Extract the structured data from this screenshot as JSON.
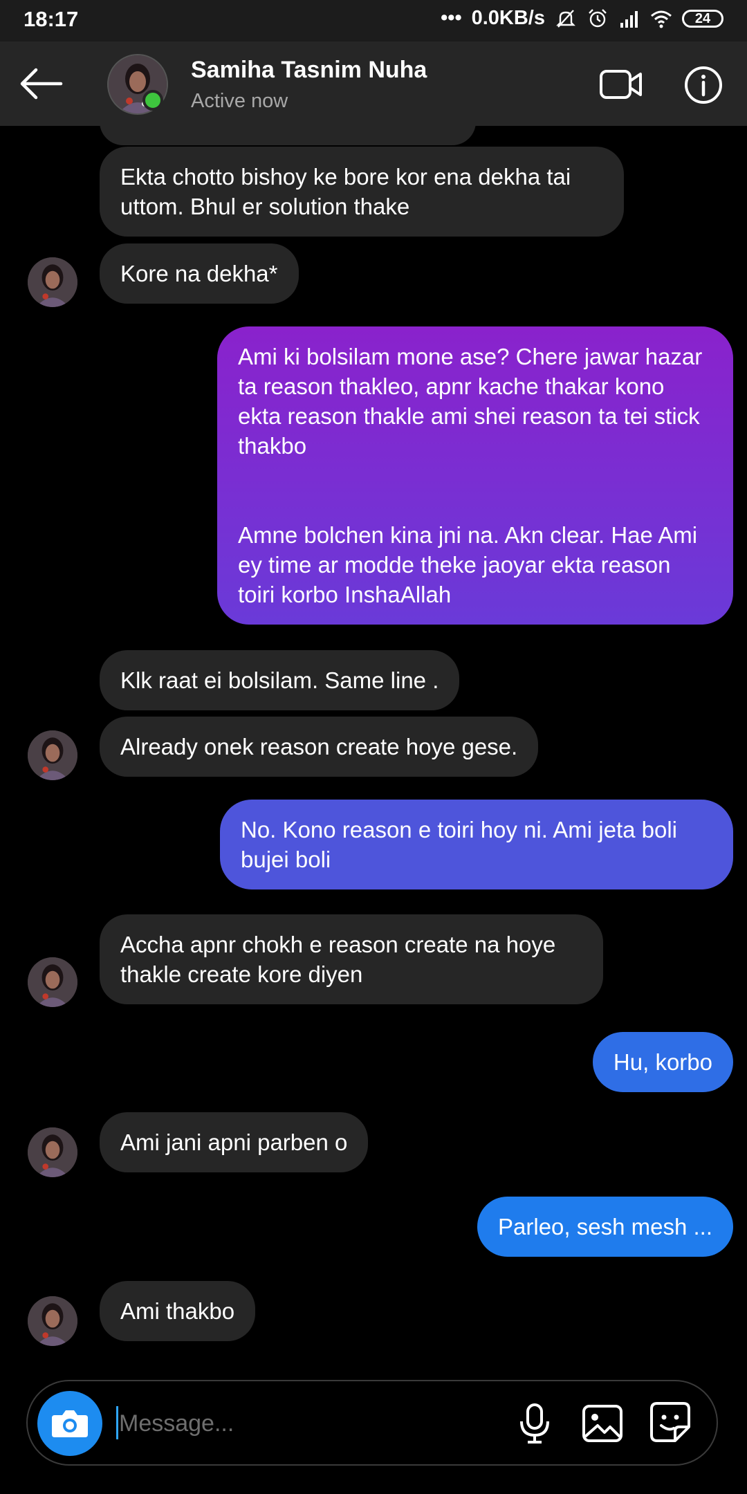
{
  "status_bar": {
    "time": "18:17",
    "network_speed": "0.0KB/s",
    "battery": "24"
  },
  "header": {
    "name": "Samiha Tasnim Nuha",
    "status": "Active now"
  },
  "messages": [
    {
      "from": "them",
      "text": "Ekta chotto bishoy ke bore kor ena dekha tai uttom. Bhul er solution thake"
    },
    {
      "from": "them",
      "text": "Kore na dekha*"
    },
    {
      "from": "me",
      "text": "Ami ki bolsilam mone ase? Chere jawar hazar ta reason thakleo, apnr kache thakar kono ekta reason thakle ami shei reason ta tei stick thakbo\n\n\nAmne bolchen kina jni na. Akn clear. Hae Ami ey time ar modde theke jaoyar ekta reason toiri korbo InshaAllah"
    },
    {
      "from": "them",
      "text": "Klk raat ei bolsilam. Same line ."
    },
    {
      "from": "them",
      "text": "Already onek reason create hoye gese."
    },
    {
      "from": "me",
      "text": "No. Kono reason e toiri hoy ni. Ami jeta boli bujei boli"
    },
    {
      "from": "them",
      "text": "Accha apnr chokh e reason create na hoye thakle create kore diyen"
    },
    {
      "from": "me",
      "text": "Hu, korbo"
    },
    {
      "from": "them",
      "text": "Ami jani apni parben o"
    },
    {
      "from": "me",
      "text": "Parleo, sesh mesh ..."
    },
    {
      "from": "them",
      "text": "Ami thakbo"
    }
  ],
  "composer": {
    "placeholder": "Message..."
  },
  "colors": {
    "incoming_bubble": "#262626",
    "gradient_purple": "#8a22cc",
    "gradient_blue": "#2f74ee",
    "accent_blue": "#1d8cf0",
    "online_green": "#3ec53e"
  }
}
